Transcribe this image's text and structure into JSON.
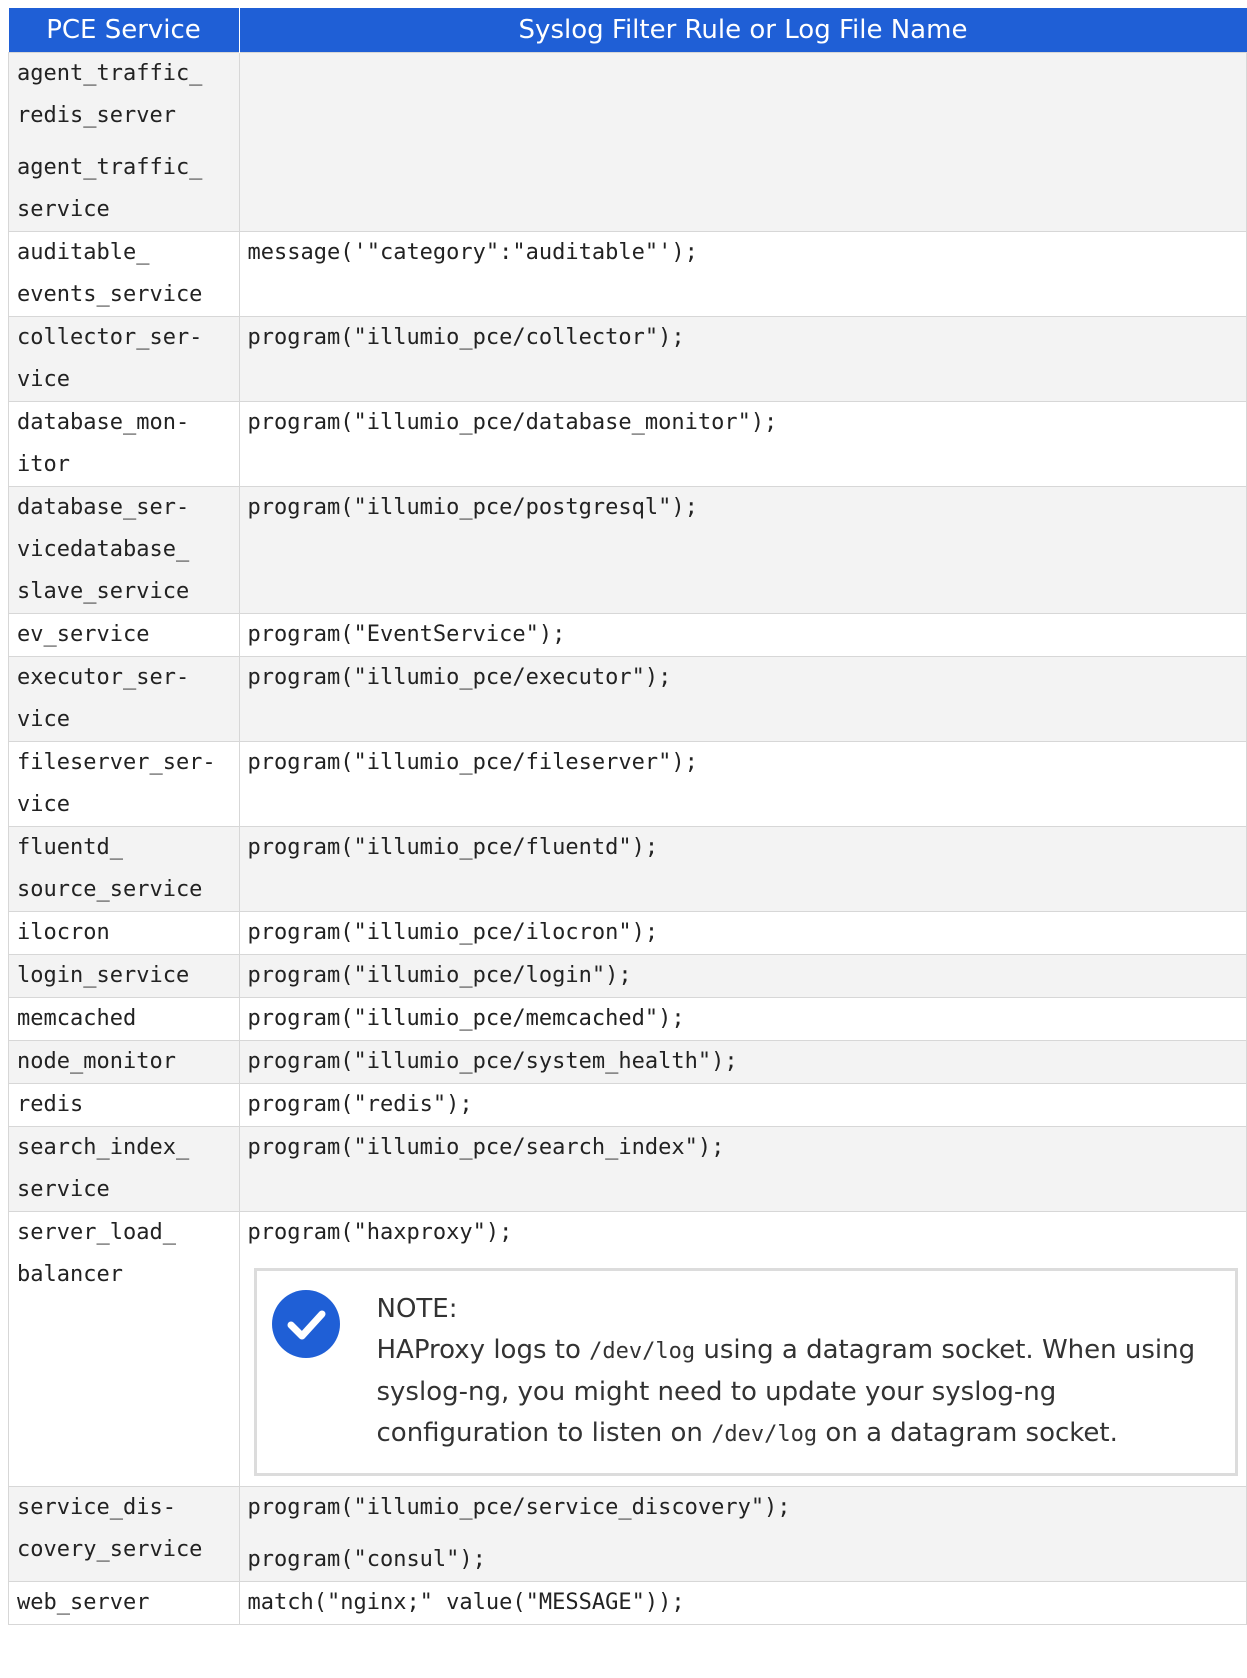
{
  "header": {
    "col1": "PCE Service",
    "col2": "Syslog Filter Rule or Log File Name"
  },
  "rows": [
    {
      "service": [
        "agent_traffic_",
        "redis_server",
        "",
        "agent_traffic_",
        "service"
      ],
      "rule": []
    },
    {
      "service": [
        "auditable_",
        "events_service"
      ],
      "rule": [
        "message('\"category\":\"auditable\"');"
      ]
    },
    {
      "service": [
        "collector_ser-",
        "vice"
      ],
      "rule": [
        "program(\"illumio_pce/collector\");"
      ]
    },
    {
      "service": [
        "database_mon-",
        "itor"
      ],
      "rule": [
        "program(\"illumio_pce/database_monitor\");"
      ]
    },
    {
      "service": [
        "database_ser-",
        "vicedatabase_",
        "slave_service"
      ],
      "rule": [
        "program(\"illumio_pce/postgresql\");"
      ]
    },
    {
      "service": [
        "ev_service"
      ],
      "rule": [
        "program(\"EventService\");"
      ]
    },
    {
      "service": [
        "executor_ser-",
        "vice"
      ],
      "rule": [
        "program(\"illumio_pce/executor\");"
      ]
    },
    {
      "service": [
        "fileserver_ser-",
        "vice"
      ],
      "rule": [
        "program(\"illumio_pce/fileserver\");"
      ]
    },
    {
      "service": [
        "fluentd_",
        "source_service"
      ],
      "rule": [
        "program(\"illumio_pce/fluentd\");"
      ]
    },
    {
      "service": [
        "ilocron"
      ],
      "rule": [
        "program(\"illumio_pce/ilocron\");"
      ]
    },
    {
      "service": [
        "login_service"
      ],
      "rule": [
        "program(\"illumio_pce/login\");"
      ]
    },
    {
      "service": [
        "memcached"
      ],
      "rule": [
        "program(\"illumio_pce/memcached\");"
      ]
    },
    {
      "service": [
        "node_monitor"
      ],
      "rule": [
        "program(\"illumio_pce/system_health\");"
      ]
    },
    {
      "service": [
        "redis"
      ],
      "rule": [
        "program(\"redis\");"
      ]
    },
    {
      "service": [
        "search_index_",
        "service"
      ],
      "rule": [
        "program(\"illumio_pce/search_index\");"
      ]
    }
  ],
  "haproxy_row": {
    "service": [
      "server_load_",
      "balancer"
    ],
    "rule": "program(\"haxproxy\");",
    "note": {
      "icon": "check-circle-icon",
      "title": "NOTE:",
      "t1": "HAProxy logs to ",
      "c1": "/dev/log",
      "t2": " using a datagram socket. When using syslog-ng, you might need to update your syslog-ng configuration to listen on ",
      "c2": "/dev/log",
      "t3": " on a datagram socket."
    }
  },
  "tail_rows": [
    {
      "service": [
        "service_dis-",
        "covery_service"
      ],
      "rule": [
        "program(\"illumio_pce/service_discovery\");",
        "",
        "program(\"consul\");"
      ]
    },
    {
      "service": [
        "web_server"
      ],
      "rule": [
        "match(\"nginx;\" value(\"MESSAGE\"));"
      ]
    }
  ],
  "colors": {
    "header_bg": "#1f5fd6",
    "note_icon": "#1f5fd6",
    "row_alt": "#f3f3f3"
  }
}
